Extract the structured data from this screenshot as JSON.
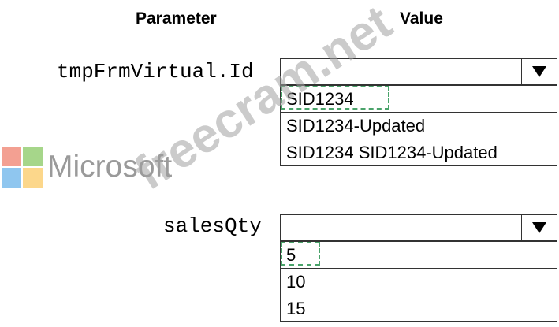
{
  "headers": {
    "parameter": "Parameter",
    "value": "Value"
  },
  "fields": [
    {
      "name": "tmpFrmVirtual.Id",
      "options": [
        "SID1234",
        "SID1234-Updated",
        "SID1234 SID1234-Updated"
      ],
      "selected_index": 0
    },
    {
      "name": "salesQty",
      "options": [
        "5",
        "10",
        "15"
      ],
      "selected_index": 0
    }
  ],
  "logo": {
    "text": "Microsoft"
  },
  "watermark": "freecram.net",
  "colors": {
    "selection_dash": "#4aa36a",
    "logo_red": "#f3a092",
    "logo_green": "#a6d68a",
    "logo_blue": "#8fc6ef",
    "logo_yellow": "#fcd78b"
  }
}
